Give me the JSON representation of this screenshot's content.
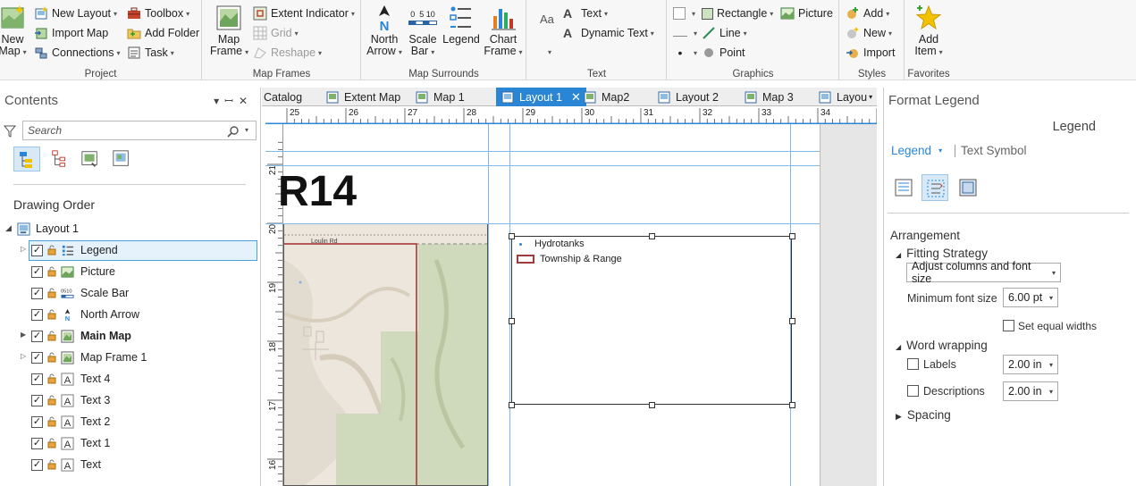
{
  "ribbon": {
    "project": {
      "label": "Project",
      "new_map": "New",
      "new_map2": "Map",
      "new_layout": "New Layout",
      "import_map": "Import Map",
      "connections": "Connections",
      "toolbox": "Toolbox",
      "add_folder": "Add Folder",
      "task": "Task"
    },
    "map_frames": {
      "label": "Map Frames",
      "map_frame": "Map",
      "map_frame2": "Frame",
      "extent_indicator": "Extent Indicator",
      "grid": "Grid",
      "reshape": "Reshape"
    },
    "map_surrounds": {
      "label": "Map Surrounds",
      "north_arrow": "North",
      "north_arrow2": "Arrow",
      "scale_bar": "Scale",
      "scale_bar2": "Bar",
      "scale_ticks": "0  5 10",
      "legend": "Legend",
      "chart_frame": "Chart",
      "chart_frame2": "Frame"
    },
    "text": {
      "label": "Text",
      "aa": "Aa",
      "text": "Text",
      "dynamic_text": "Dynamic Text"
    },
    "graphics": {
      "label": "Graphics",
      "rectangle": "Rectangle",
      "picture": "Picture",
      "line": "Line",
      "point": "Point"
    },
    "styles": {
      "label": "Styles",
      "add": "Add",
      "new": "New",
      "import": "Import"
    },
    "favorites": {
      "label": "Favorites",
      "add_item": "Add",
      "add_item2": "Item"
    }
  },
  "contents": {
    "title": "Contents",
    "search_placeholder": "Search",
    "drawing_order": "Drawing Order",
    "root": "Layout 1",
    "items": [
      {
        "label": "Legend",
        "icon": "legend-icon",
        "expandable": true,
        "bold": false,
        "selected": true
      },
      {
        "label": "Picture",
        "icon": "picture-icon",
        "expandable": false,
        "bold": false,
        "selected": false
      },
      {
        "label": "Scale Bar",
        "icon": "scale-bar-icon",
        "expandable": false,
        "bold": false,
        "selected": false
      },
      {
        "label": "North Arrow",
        "icon": "north-arrow-icon",
        "expandable": false,
        "bold": false,
        "selected": false
      },
      {
        "label": "Main Map",
        "icon": "map-frame-icon",
        "expandable": true,
        "bold": true,
        "selected": false
      },
      {
        "label": "Map Frame 1",
        "icon": "map-frame-icon",
        "expandable": true,
        "bold": false,
        "selected": false
      },
      {
        "label": "Text 4",
        "icon": "text-icon",
        "expandable": false,
        "bold": false,
        "selected": false
      },
      {
        "label": "Text 3",
        "icon": "text-icon",
        "expandable": false,
        "bold": false,
        "selected": false
      },
      {
        "label": "Text 2",
        "icon": "text-icon",
        "expandable": false,
        "bold": false,
        "selected": false
      },
      {
        "label": "Text 1",
        "icon": "text-icon",
        "expandable": false,
        "bold": false,
        "selected": false
      },
      {
        "label": "Text",
        "icon": "text-icon",
        "expandable": false,
        "bold": false,
        "selected": false
      }
    ]
  },
  "tabs": [
    {
      "label": "Catalog",
      "active": false
    },
    {
      "label": "Extent Map",
      "active": false
    },
    {
      "label": "Map 1",
      "active": false
    },
    {
      "label": "Layout 1",
      "active": true
    },
    {
      "label": "Map2",
      "active": false
    },
    {
      "label": "Layout 2",
      "active": false
    },
    {
      "label": "Map 3",
      "active": false
    },
    {
      "label": "Layou",
      "active": false
    }
  ],
  "ruler": {
    "top": [
      "25",
      "26",
      "27",
      "28",
      "29",
      "30",
      "31",
      "32",
      "33",
      "34"
    ],
    "left": [
      "21",
      "20",
      "19",
      "18",
      "17",
      "16"
    ]
  },
  "layout": {
    "title_text": "R14",
    "map_road_label": "Loulin Rd",
    "legend_items": [
      "Hydrotanks",
      "Township & Range"
    ]
  },
  "format_pane": {
    "title": "Format Legend",
    "element": "Legend",
    "selector": "Legend",
    "text_symbol": "Text Symbol",
    "arrangement": "Arrangement",
    "fitting_strategy": "Fitting Strategy",
    "fitting_value": "Adjust columns and font size",
    "min_font_label": "Minimum font size",
    "min_font_value": "6.00 pt",
    "equal_widths": "Set equal widths",
    "word_wrapping": "Word wrapping",
    "labels": "Labels",
    "labels_value": "2.00 in",
    "descriptions": "Descriptions",
    "descriptions_value": "2.00 in",
    "spacing": "Spacing"
  },
  "colors": {
    "accent": "#2a86d5",
    "guide": "#7fb7e6",
    "boundary": "#a33a3a",
    "map_green": "#cfd9bb",
    "map_relief": "#ece6dc"
  }
}
